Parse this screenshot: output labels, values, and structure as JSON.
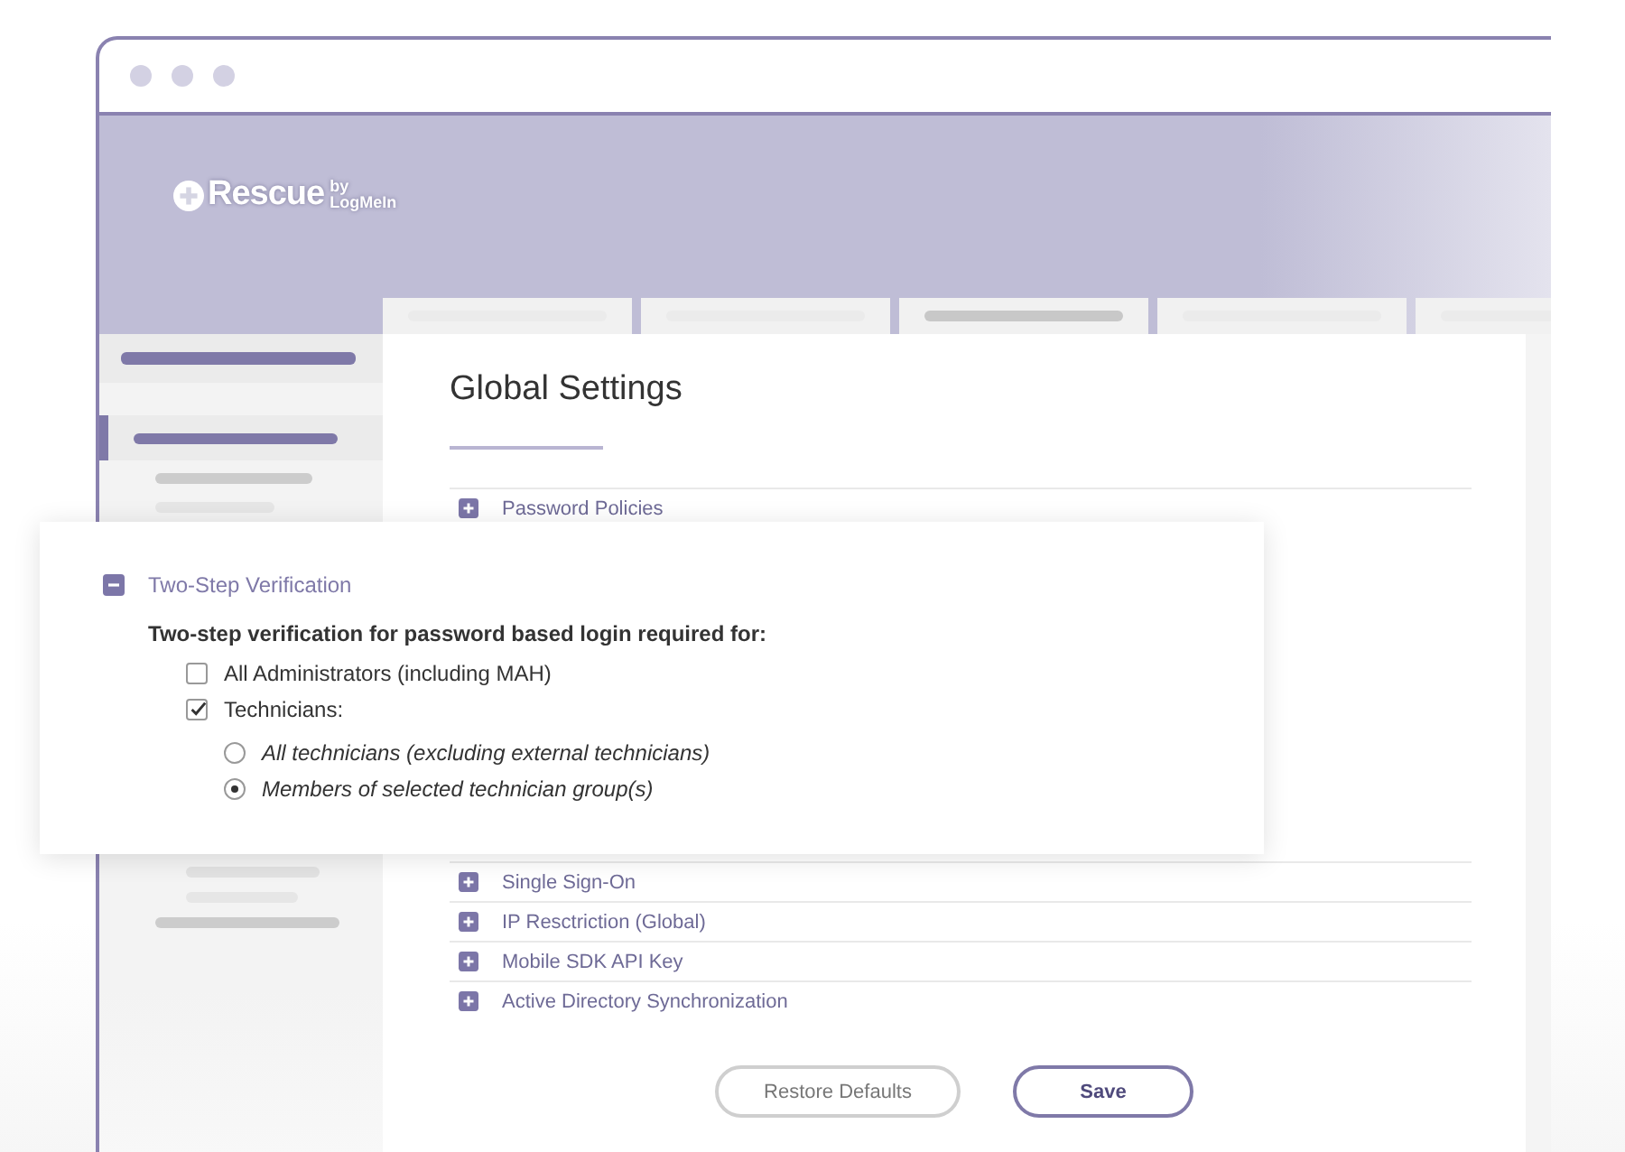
{
  "logo": {
    "name": "Rescue",
    "by": "by",
    "brand": "LogMeIn"
  },
  "tabs": [
    {
      "selected": false
    },
    {
      "selected": false
    },
    {
      "selected": true
    },
    {
      "selected": false
    },
    {
      "selected": false
    }
  ],
  "sidebar": {
    "items": [
      {
        "selected": true
      },
      {
        "selected": false
      },
      {
        "selected": false
      },
      {
        "selected": false
      },
      {
        "selected": false
      },
      {
        "selected": false
      }
    ]
  },
  "page_title": "Global Settings",
  "sections": [
    {
      "title": "Password Policies",
      "expanded": false
    },
    {
      "title": "Single Sign-On",
      "expanded": false
    },
    {
      "title": "IP Resctriction (Global)",
      "expanded": false
    },
    {
      "title": "Mobile SDK API Key",
      "expanded": false
    },
    {
      "title": "Active Directory Synchronization",
      "expanded": false
    }
  ],
  "expanded_section": {
    "title": "Two-Step Verification",
    "expanded": true,
    "prompt": "Two-step verification for password based login required for:",
    "options": [
      {
        "kind": "checkbox",
        "label": "All Administrators (including MAH)",
        "checked": false
      },
      {
        "kind": "checkbox",
        "label": "Technicians:",
        "checked": true
      },
      {
        "kind": "radio",
        "label": "All technicians (excluding external technicians)",
        "selected": false
      },
      {
        "kind": "radio",
        "label": "Members of selected technician group(s)",
        "selected": true
      }
    ]
  },
  "buttons": [
    {
      "label": "Restore Defaults",
      "kind": "secondary"
    },
    {
      "label": "Save",
      "kind": "primary"
    }
  ]
}
